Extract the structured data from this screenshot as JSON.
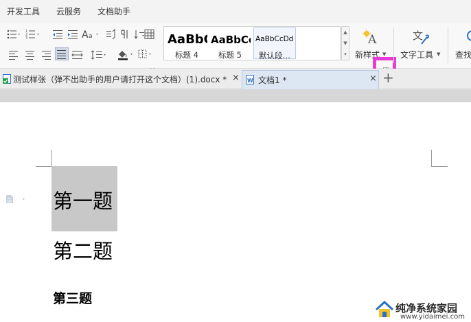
{
  "menu": {
    "tabs": [
      "开发工具",
      "云服务",
      "文档助手"
    ]
  },
  "ribbon": {
    "styles": [
      {
        "preview": "AaBbC",
        "name": "标题 4"
      },
      {
        "preview": "AaBbCc",
        "name": "标题 5"
      },
      {
        "preview": "AaBbCcDd",
        "name": "默认段…"
      }
    ],
    "new_style_label": "新样式",
    "text_tools_label": "文字工具",
    "find_label": "查找"
  },
  "tabs": {
    "doc1": {
      "title": "测试样张（弹不出助手的用户请打开这个文档）(1).docx *",
      "close": "×"
    },
    "doc2": {
      "title": "文档1 *",
      "close": "×"
    },
    "new_tab": "+"
  },
  "document": {
    "line1": "第一题",
    "line2": "第二题",
    "line3": "第三题"
  },
  "watermark": {
    "name": "纯净系统家园",
    "url": "www.yidaimei.com"
  },
  "colors": {
    "highlight_box": "#e83ad8",
    "selection": "#c8c8c8",
    "accent_blue": "#2a6fc9"
  }
}
